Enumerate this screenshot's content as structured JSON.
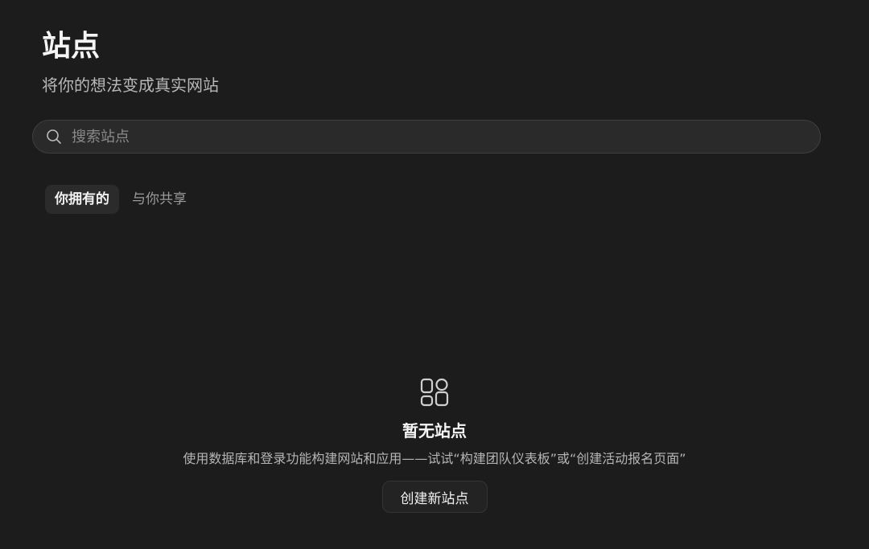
{
  "header": {
    "title": "站点",
    "subtitle": "将你的想法变成真实网站"
  },
  "search": {
    "placeholder": "搜索站点",
    "value": "",
    "icon": "search-icon"
  },
  "tabs": [
    {
      "label": "你拥有的",
      "active": true
    },
    {
      "label": "与你共享",
      "active": false
    }
  ],
  "empty_state": {
    "icon": "sites-grid-icon",
    "title": "暂无站点",
    "description": "使用数据库和登录功能构建网站和应用——试试“构建团队仪表板”或“创建活动报名页面”",
    "button_label": "创建新站点"
  },
  "colors": {
    "background": "#1c1c1c",
    "search_background": "#2a2a2a",
    "active_tab_background": "#2b2b2b",
    "text_primary": "#f5f5f5",
    "text_secondary": "#9a9a9a"
  }
}
